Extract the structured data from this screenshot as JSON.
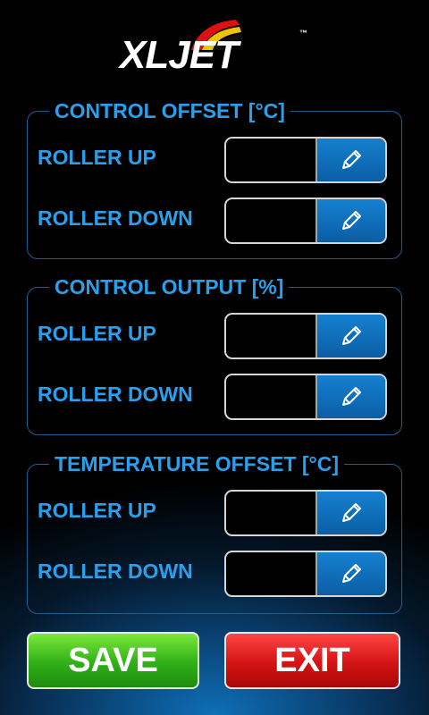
{
  "logo": {
    "text": "XLJET",
    "tm": "™"
  },
  "groups": [
    {
      "title": "CONTROL OFFSET [°C]",
      "rows": [
        {
          "label": "ROLLER UP",
          "value": ""
        },
        {
          "label": "ROLLER DOWN",
          "value": ""
        }
      ]
    },
    {
      "title": "CONTROL OUTPUT [%]",
      "rows": [
        {
          "label": "ROLLER UP",
          "value": ""
        },
        {
          "label": "ROLLER DOWN",
          "value": ""
        }
      ]
    },
    {
      "title": "TEMPERATURE OFFSET [°C]",
      "rows": [
        {
          "label": "ROLLER UP",
          "value": ""
        },
        {
          "label": "ROLLER DOWN",
          "value": ""
        }
      ]
    }
  ],
  "buttons": {
    "save": "SAVE",
    "exit": "EXIT"
  },
  "icons": {
    "edit": "pencil-icon"
  },
  "colors": {
    "accent": "#2aa0ec",
    "save": "#3cc21e",
    "exit": "#e01a1a",
    "edit": "#1170c0"
  }
}
